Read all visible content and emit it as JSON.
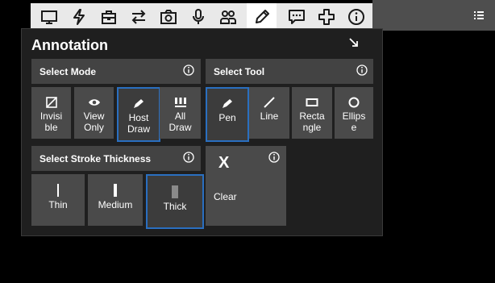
{
  "toolbar": {
    "icons": [
      "monitor-icon",
      "lightning-icon",
      "briefcase-icon",
      "transfer-arrows-icon",
      "camera-icon",
      "microphone-icon",
      "users-icon",
      "pencil-icon",
      "chat-icon",
      "plus-icon",
      "info-icon"
    ],
    "active": "pencil-icon",
    "menu_icon": "list-menu-icon"
  },
  "panel": {
    "title": "Annotation",
    "select_mode": {
      "label": "Select Mode",
      "options": [
        "Invisi\nble",
        "View\nOnly",
        "Host\nDraw",
        "All\nDraw"
      ],
      "selected": "Host Draw"
    },
    "select_tool": {
      "label": "Select Tool",
      "options": [
        "Pen",
        "Line",
        "Recta\nngle",
        "Ellips\ne"
      ],
      "selected": "Pen"
    },
    "stroke": {
      "label": "Select Stroke Thickness",
      "options": [
        "Thin",
        "Medium",
        "Thick"
      ],
      "selected": "Thick"
    },
    "clear": {
      "symbol": "X",
      "label": "Clear"
    }
  },
  "colors": {
    "accent": "#2a6fc0",
    "panel_bg": "#1f1f1f",
    "section_bg": "#434343",
    "button_bg": "#4a4a4a"
  }
}
